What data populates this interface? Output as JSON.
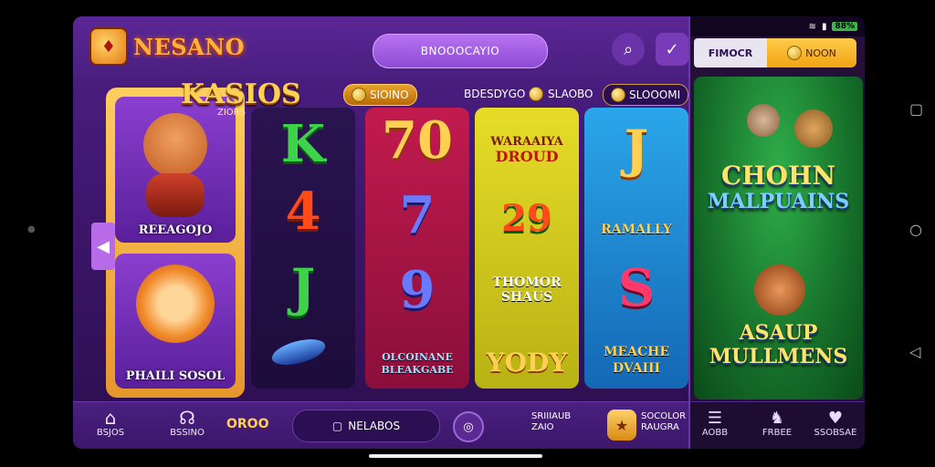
{
  "app": {
    "brand": "NESANO",
    "search_pill": "BNOOOCAYIO",
    "kasios_title": "KASIOS",
    "kasios_sub": "ZIORS"
  },
  "chips": [
    {
      "label": "SIOINO"
    },
    {
      "label": "BDESDYGO"
    },
    {
      "label": "SLAOBO"
    },
    {
      "label": "SLOOOMI"
    }
  ],
  "characters": [
    {
      "label": "REEAGOJO"
    },
    {
      "label": "PHAILI SOSOL"
    }
  ],
  "reels": [
    {
      "symbols": [
        "K",
        "4",
        "J"
      ],
      "color": "#1c0c3a"
    },
    {
      "symbols": [
        "70",
        "7",
        "9"
      ],
      "labels": [
        "OLCOINANE",
        "BLEAKGABE"
      ],
      "color": "#8a0f3a"
    },
    {
      "labels": [
        "WARAAIYA",
        "DROUD",
        "29",
        "THOMOR",
        "SHAUS",
        "YODY"
      ],
      "color": "#b8b214"
    },
    {
      "labels": [
        "J",
        "RAMALLY",
        "S",
        "MEACHE",
        "DVAIII"
      ],
      "color": "#1468b4"
    }
  ],
  "bottom": {
    "nav": [
      {
        "label": "BSJOS",
        "icon": "home-icon"
      },
      {
        "label": "BSSINO",
        "icon": "headset-icon"
      }
    ],
    "coins": "OROO",
    "pill_label": "NELABOS",
    "promo1_line1": "SRIIIAUB",
    "promo1_line2": "ZAIO",
    "promo2_line1": "SOCOLOR",
    "promo2_line2": "RAUGRA"
  },
  "right": {
    "status_batt": "88%",
    "tab1": "FIMOCR",
    "tab2": "NOON",
    "title1_line1": "CHOHN",
    "title1_line2": "MALPUAINS",
    "title2_line1": "ASAUP",
    "title2_line2": "MULLMENS",
    "nav": [
      {
        "label": "AOBB",
        "icon": "menu-icon"
      },
      {
        "label": "FRBEE",
        "icon": "bird-icon"
      },
      {
        "label": "SSOBSAE",
        "icon": "heart-icon"
      }
    ]
  }
}
